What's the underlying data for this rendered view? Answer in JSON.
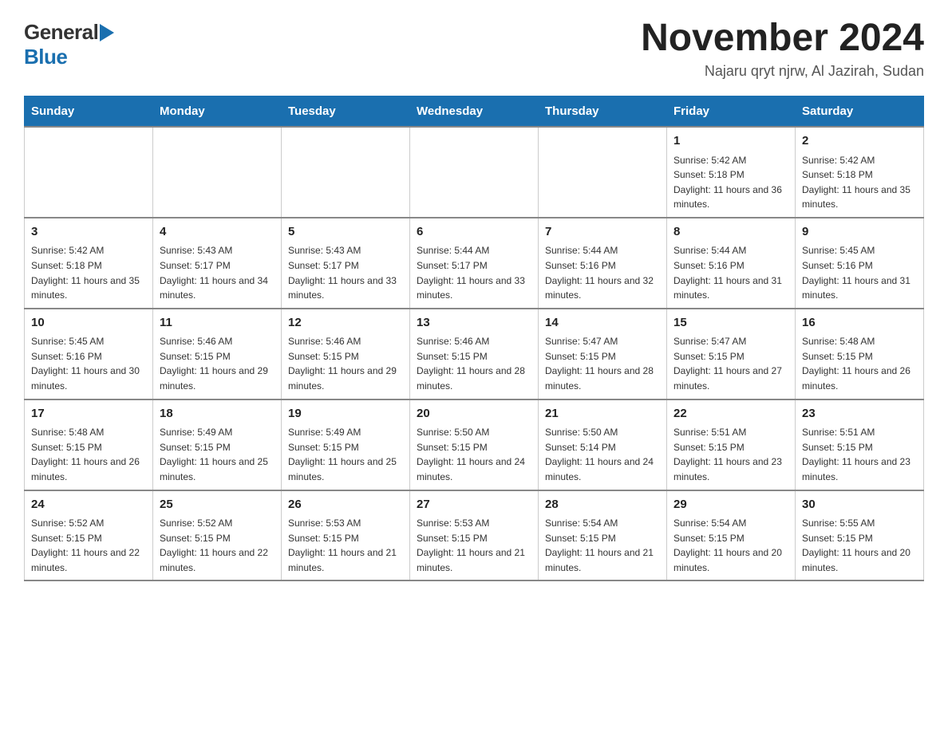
{
  "header": {
    "logo_general": "General",
    "logo_blue": "Blue",
    "main_title": "November 2024",
    "subtitle": "Najaru qryt njrw, Al Jazirah, Sudan"
  },
  "calendar": {
    "days_of_week": [
      "Sunday",
      "Monday",
      "Tuesday",
      "Wednesday",
      "Thursday",
      "Friday",
      "Saturday"
    ],
    "weeks": [
      [
        {
          "day": "",
          "sunrise": "",
          "sunset": "",
          "daylight": ""
        },
        {
          "day": "",
          "sunrise": "",
          "sunset": "",
          "daylight": ""
        },
        {
          "day": "",
          "sunrise": "",
          "sunset": "",
          "daylight": ""
        },
        {
          "day": "",
          "sunrise": "",
          "sunset": "",
          "daylight": ""
        },
        {
          "day": "",
          "sunrise": "",
          "sunset": "",
          "daylight": ""
        },
        {
          "day": "1",
          "sunrise": "Sunrise: 5:42 AM",
          "sunset": "Sunset: 5:18 PM",
          "daylight": "Daylight: 11 hours and 36 minutes."
        },
        {
          "day": "2",
          "sunrise": "Sunrise: 5:42 AM",
          "sunset": "Sunset: 5:18 PM",
          "daylight": "Daylight: 11 hours and 35 minutes."
        }
      ],
      [
        {
          "day": "3",
          "sunrise": "Sunrise: 5:42 AM",
          "sunset": "Sunset: 5:18 PM",
          "daylight": "Daylight: 11 hours and 35 minutes."
        },
        {
          "day": "4",
          "sunrise": "Sunrise: 5:43 AM",
          "sunset": "Sunset: 5:17 PM",
          "daylight": "Daylight: 11 hours and 34 minutes."
        },
        {
          "day": "5",
          "sunrise": "Sunrise: 5:43 AM",
          "sunset": "Sunset: 5:17 PM",
          "daylight": "Daylight: 11 hours and 33 minutes."
        },
        {
          "day": "6",
          "sunrise": "Sunrise: 5:44 AM",
          "sunset": "Sunset: 5:17 PM",
          "daylight": "Daylight: 11 hours and 33 minutes."
        },
        {
          "day": "7",
          "sunrise": "Sunrise: 5:44 AM",
          "sunset": "Sunset: 5:16 PM",
          "daylight": "Daylight: 11 hours and 32 minutes."
        },
        {
          "day": "8",
          "sunrise": "Sunrise: 5:44 AM",
          "sunset": "Sunset: 5:16 PM",
          "daylight": "Daylight: 11 hours and 31 minutes."
        },
        {
          "day": "9",
          "sunrise": "Sunrise: 5:45 AM",
          "sunset": "Sunset: 5:16 PM",
          "daylight": "Daylight: 11 hours and 31 minutes."
        }
      ],
      [
        {
          "day": "10",
          "sunrise": "Sunrise: 5:45 AM",
          "sunset": "Sunset: 5:16 PM",
          "daylight": "Daylight: 11 hours and 30 minutes."
        },
        {
          "day": "11",
          "sunrise": "Sunrise: 5:46 AM",
          "sunset": "Sunset: 5:15 PM",
          "daylight": "Daylight: 11 hours and 29 minutes."
        },
        {
          "day": "12",
          "sunrise": "Sunrise: 5:46 AM",
          "sunset": "Sunset: 5:15 PM",
          "daylight": "Daylight: 11 hours and 29 minutes."
        },
        {
          "day": "13",
          "sunrise": "Sunrise: 5:46 AM",
          "sunset": "Sunset: 5:15 PM",
          "daylight": "Daylight: 11 hours and 28 minutes."
        },
        {
          "day": "14",
          "sunrise": "Sunrise: 5:47 AM",
          "sunset": "Sunset: 5:15 PM",
          "daylight": "Daylight: 11 hours and 28 minutes."
        },
        {
          "day": "15",
          "sunrise": "Sunrise: 5:47 AM",
          "sunset": "Sunset: 5:15 PM",
          "daylight": "Daylight: 11 hours and 27 minutes."
        },
        {
          "day": "16",
          "sunrise": "Sunrise: 5:48 AM",
          "sunset": "Sunset: 5:15 PM",
          "daylight": "Daylight: 11 hours and 26 minutes."
        }
      ],
      [
        {
          "day": "17",
          "sunrise": "Sunrise: 5:48 AM",
          "sunset": "Sunset: 5:15 PM",
          "daylight": "Daylight: 11 hours and 26 minutes."
        },
        {
          "day": "18",
          "sunrise": "Sunrise: 5:49 AM",
          "sunset": "Sunset: 5:15 PM",
          "daylight": "Daylight: 11 hours and 25 minutes."
        },
        {
          "day": "19",
          "sunrise": "Sunrise: 5:49 AM",
          "sunset": "Sunset: 5:15 PM",
          "daylight": "Daylight: 11 hours and 25 minutes."
        },
        {
          "day": "20",
          "sunrise": "Sunrise: 5:50 AM",
          "sunset": "Sunset: 5:15 PM",
          "daylight": "Daylight: 11 hours and 24 minutes."
        },
        {
          "day": "21",
          "sunrise": "Sunrise: 5:50 AM",
          "sunset": "Sunset: 5:14 PM",
          "daylight": "Daylight: 11 hours and 24 minutes."
        },
        {
          "day": "22",
          "sunrise": "Sunrise: 5:51 AM",
          "sunset": "Sunset: 5:15 PM",
          "daylight": "Daylight: 11 hours and 23 minutes."
        },
        {
          "day": "23",
          "sunrise": "Sunrise: 5:51 AM",
          "sunset": "Sunset: 5:15 PM",
          "daylight": "Daylight: 11 hours and 23 minutes."
        }
      ],
      [
        {
          "day": "24",
          "sunrise": "Sunrise: 5:52 AM",
          "sunset": "Sunset: 5:15 PM",
          "daylight": "Daylight: 11 hours and 22 minutes."
        },
        {
          "day": "25",
          "sunrise": "Sunrise: 5:52 AM",
          "sunset": "Sunset: 5:15 PM",
          "daylight": "Daylight: 11 hours and 22 minutes."
        },
        {
          "day": "26",
          "sunrise": "Sunrise: 5:53 AM",
          "sunset": "Sunset: 5:15 PM",
          "daylight": "Daylight: 11 hours and 21 minutes."
        },
        {
          "day": "27",
          "sunrise": "Sunrise: 5:53 AM",
          "sunset": "Sunset: 5:15 PM",
          "daylight": "Daylight: 11 hours and 21 minutes."
        },
        {
          "day": "28",
          "sunrise": "Sunrise: 5:54 AM",
          "sunset": "Sunset: 5:15 PM",
          "daylight": "Daylight: 11 hours and 21 minutes."
        },
        {
          "day": "29",
          "sunrise": "Sunrise: 5:54 AM",
          "sunset": "Sunset: 5:15 PM",
          "daylight": "Daylight: 11 hours and 20 minutes."
        },
        {
          "day": "30",
          "sunrise": "Sunrise: 5:55 AM",
          "sunset": "Sunset: 5:15 PM",
          "daylight": "Daylight: 11 hours and 20 minutes."
        }
      ]
    ]
  }
}
